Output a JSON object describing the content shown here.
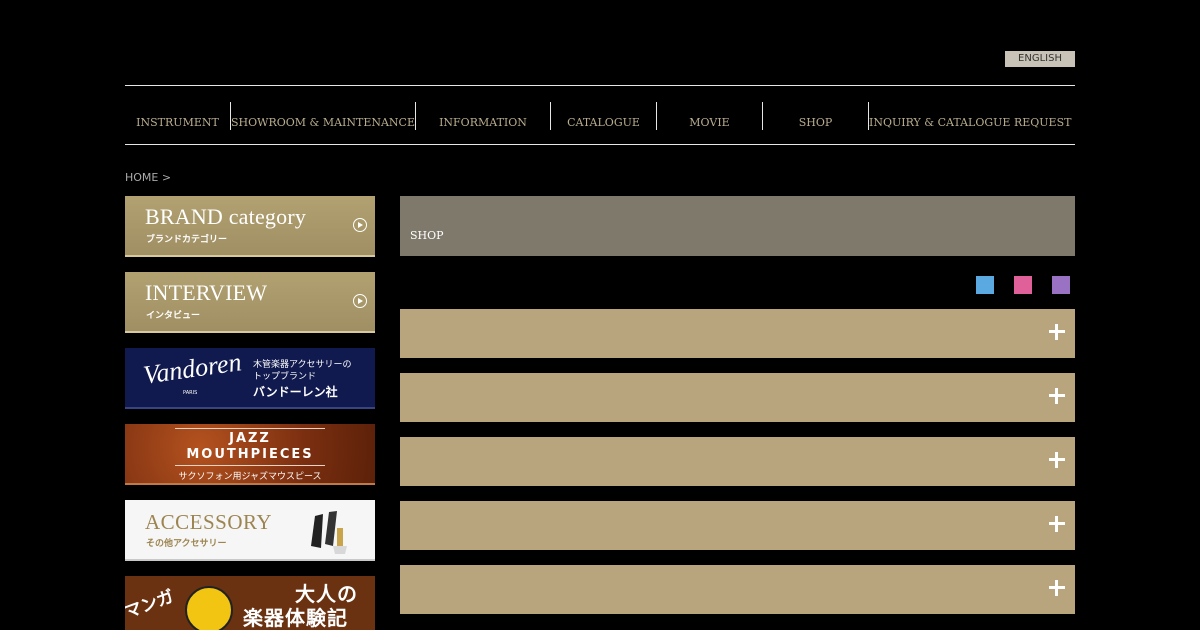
{
  "header": {
    "lang_button": "ENGLISH"
  },
  "nav": [
    "INSTRUMENT",
    "SHOWROOM & MAINTENANCE",
    "INFORMATION",
    "CATALOGUE",
    "MOVIE",
    "SHOP",
    "INQUIRY & CATALOGUE REQUEST"
  ],
  "breadcrumb": "HOME >",
  "sidebar": {
    "brand": {
      "title": "BRAND category",
      "sub": "ブランドカテゴリー"
    },
    "interview": {
      "title": "INTERVIEW",
      "sub": "インタビュー"
    },
    "vandoren": {
      "logo": "Vandoren",
      "paris": "PARIS",
      "line1": "木管楽器アクセサリーの",
      "line2": "トップブランド",
      "line3": "バンドーレン社"
    },
    "jazz": {
      "line1": "JAZZ",
      "line2": "MOUTHPIECES",
      "sub": "サクソフォン用ジャズマウスピース"
    },
    "accessory": {
      "title": "ACCESSORY",
      "sub": "その他アクセサリー"
    },
    "manga": {
      "tag": "マンガ",
      "line1": "大人の",
      "line2": "楽器体験記"
    }
  },
  "main": {
    "title": "SHOP",
    "swatches": [
      "#5aa9e0",
      "#e0609a",
      "#9a72c4"
    ],
    "accordion_count": 5
  },
  "colors": {
    "background": "#000000",
    "header_bar": "#7e796b",
    "accordion_bar": "#b8a47d",
    "nav_text": "#b9ad8f"
  }
}
